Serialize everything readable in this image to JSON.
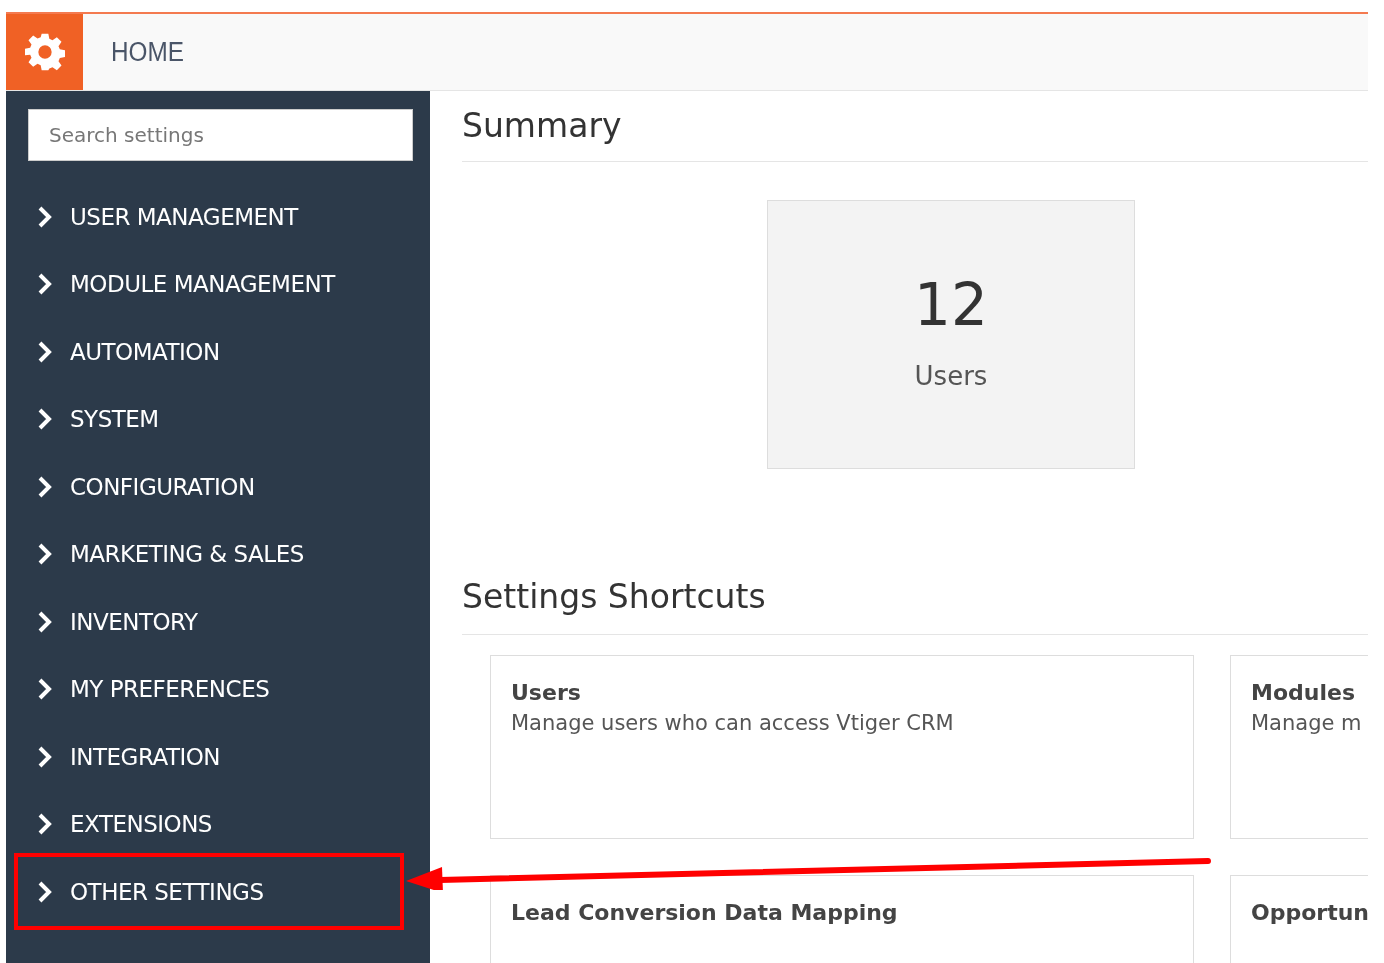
{
  "header": {
    "title": "HOME"
  },
  "sidebar": {
    "search": {
      "placeholder": "Search settings"
    },
    "items": [
      {
        "label": "USER MANAGEMENT",
        "highlighted": false
      },
      {
        "label": "MODULE MANAGEMENT",
        "highlighted": false
      },
      {
        "label": "AUTOMATION",
        "highlighted": false
      },
      {
        "label": "SYSTEM",
        "highlighted": false
      },
      {
        "label": "CONFIGURATION",
        "highlighted": false
      },
      {
        "label": "MARKETING & SALES",
        "highlighted": false
      },
      {
        "label": "INVENTORY",
        "highlighted": false
      },
      {
        "label": "MY PREFERENCES",
        "highlighted": false
      },
      {
        "label": "INTEGRATION",
        "highlighted": false
      },
      {
        "label": "EXTENSIONS",
        "highlighted": false
      },
      {
        "label": "OTHER SETTINGS",
        "highlighted": true
      }
    ]
  },
  "summary": {
    "title": "Summary",
    "stats": [
      {
        "value": "12",
        "label": "Users"
      }
    ]
  },
  "shortcuts": {
    "title": "Settings Shortcuts",
    "cards": [
      {
        "title": "Users",
        "description": "Manage users who can access Vtiger CRM"
      },
      {
        "title": "Modules",
        "description": "Manage m"
      },
      {
        "title": "Lead Conversion Data Mapping"
      },
      {
        "title": "Opportun"
      }
    ]
  }
}
